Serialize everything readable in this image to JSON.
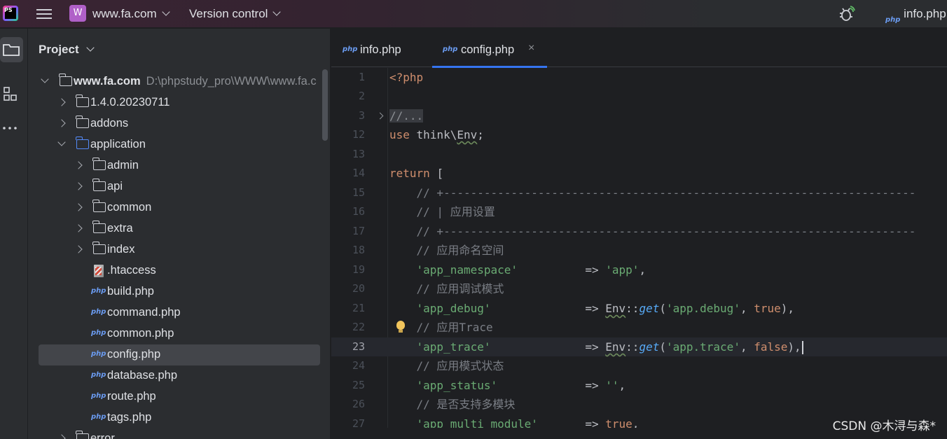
{
  "titlebar": {
    "app_logo_text": "PS",
    "project_badge": "W",
    "project_name": "www.fa.com",
    "vcs_label": "Version control",
    "right_file": "info.php",
    "php_tag": "php"
  },
  "toolstrip": {
    "items": [
      "project-icon",
      "structure-icon",
      "more-icon"
    ]
  },
  "project_panel": {
    "title": "Project",
    "root": {
      "label": "www.fa.com",
      "path": "D:\\phpstudy_pro\\WWW\\www.fa.c"
    },
    "rows": [
      {
        "label": "1.4.0.20230711",
        "kind": "folder"
      },
      {
        "label": "addons",
        "kind": "folder"
      },
      {
        "label": "application",
        "kind": "folder"
      },
      {
        "label": "admin",
        "kind": "folder"
      },
      {
        "label": "api",
        "kind": "folder"
      },
      {
        "label": "common",
        "kind": "folder"
      },
      {
        "label": "extra",
        "kind": "folder"
      },
      {
        "label": "index",
        "kind": "folder"
      },
      {
        "label": ".htaccess",
        "kind": "file"
      },
      {
        "label": "build.php",
        "kind": "php"
      },
      {
        "label": "command.php",
        "kind": "php"
      },
      {
        "label": "common.php",
        "kind": "php"
      },
      {
        "label": "config.php",
        "kind": "php"
      },
      {
        "label": "database.php",
        "kind": "php"
      },
      {
        "label": "route.php",
        "kind": "php"
      },
      {
        "label": "tags.php",
        "kind": "php"
      },
      {
        "label": "error",
        "kind": "folder"
      }
    ],
    "php_tag": "php"
  },
  "editor": {
    "tabs": [
      {
        "label": "info.php",
        "active": false
      },
      {
        "label": "config.php",
        "active": true
      }
    ],
    "tab_close": "×",
    "php_tag": "php",
    "line_numbers": [
      "1",
      "2",
      "3",
      "12",
      "13",
      "14",
      "15",
      "16",
      "17",
      "18",
      "19",
      "20",
      "21",
      "22",
      "23",
      "24",
      "25",
      "26",
      "27"
    ],
    "current_line": "23"
  },
  "watermark": "CSDN @木浔与森*"
}
